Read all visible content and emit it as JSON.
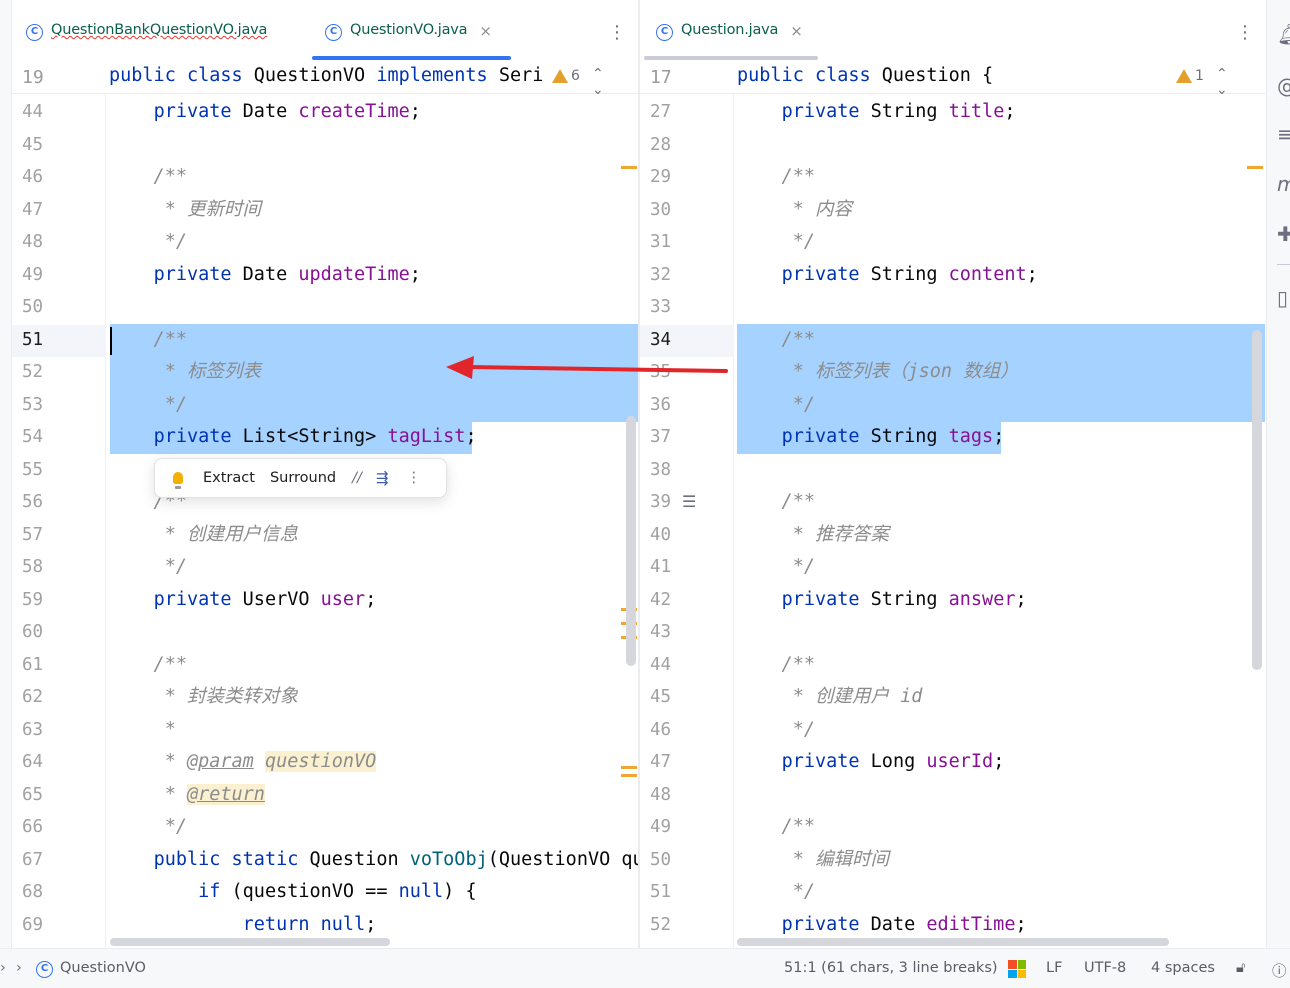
{
  "left_editor": {
    "tabs": [
      {
        "name": "QuestionBankQuestionVO.java",
        "icon": "class-icon",
        "error": true
      },
      {
        "name": "QuestionVO.java",
        "icon": "class-icon",
        "active": true,
        "close": "×"
      }
    ],
    "more": "⋮",
    "sticky": {
      "line_number": "19",
      "code": "public class QuestionVO implements Seri"
    },
    "warnings": "6",
    "nav": "^ v",
    "lines": [
      {
        "n": "44",
        "text": "    private Date createTime;"
      },
      {
        "n": "45",
        "text": ""
      },
      {
        "n": "46",
        "text": "    /**"
      },
      {
        "n": "47",
        "text": "     * 更新时间"
      },
      {
        "n": "48",
        "text": "     */"
      },
      {
        "n": "49",
        "text": "    private Date updateTime;"
      },
      {
        "n": "50",
        "text": ""
      },
      {
        "n": "51",
        "text": "    /**"
      },
      {
        "n": "52",
        "text": "     * 标签列表"
      },
      {
        "n": "53",
        "text": "     */"
      },
      {
        "n": "54",
        "text": "    private List<String> tagList;"
      },
      {
        "n": "55",
        "text": ""
      },
      {
        "n": "56",
        "text": "    /**"
      },
      {
        "n": "57",
        "text": "     * 创建用户信息"
      },
      {
        "n": "58",
        "text": "     */"
      },
      {
        "n": "59",
        "text": "    private UserVO user;"
      },
      {
        "n": "60",
        "text": ""
      },
      {
        "n": "61",
        "text": "    /**"
      },
      {
        "n": "62",
        "text": "     * 封装类转对象"
      },
      {
        "n": "63",
        "text": "     *"
      },
      {
        "n": "64",
        "text": "     * @param questionVO"
      },
      {
        "n": "65",
        "text": "     * @return"
      },
      {
        "n": "66",
        "text": "     */"
      },
      {
        "n": "67",
        "text": "    public static Question voToObj(QuestionVO qu"
      },
      {
        "n": "68",
        "text": "        if (questionVO == null) {"
      },
      {
        "n": "69",
        "text": "            return null;"
      }
    ],
    "popup": {
      "extract": "Extract",
      "surround": "Surround",
      "comment": "//",
      "more": "⋮"
    }
  },
  "right_editor": {
    "tabs": [
      {
        "name": "Question.java",
        "icon": "class-icon",
        "active": true,
        "close": "×"
      }
    ],
    "more": "⋮",
    "sticky": {
      "line_number": "17",
      "code": "public class Question {"
    },
    "warnings": "1",
    "nav": "^ v",
    "lines": [
      {
        "n": "27",
        "text": "    private String title;"
      },
      {
        "n": "28",
        "text": ""
      },
      {
        "n": "29",
        "text": "    /**"
      },
      {
        "n": "30",
        "text": "     * 内容"
      },
      {
        "n": "31",
        "text": "     */"
      },
      {
        "n": "32",
        "text": "    private String content;"
      },
      {
        "n": "33",
        "text": ""
      },
      {
        "n": "34",
        "text": "    /**"
      },
      {
        "n": "35",
        "text": "     * 标签列表（json 数组）"
      },
      {
        "n": "36",
        "text": "     */"
      },
      {
        "n": "37",
        "text": "    private String tags;"
      },
      {
        "n": "38",
        "text": ""
      },
      {
        "n": "39",
        "text": "    /**"
      },
      {
        "n": "40",
        "text": "     * 推荐答案"
      },
      {
        "n": "41",
        "text": "     */"
      },
      {
        "n": "42",
        "text": "    private String answer;"
      },
      {
        "n": "43",
        "text": ""
      },
      {
        "n": "44",
        "text": "    /**"
      },
      {
        "n": "45",
        "text": "     * 创建用户 id"
      },
      {
        "n": "46",
        "text": "     */"
      },
      {
        "n": "47",
        "text": "    private Long userId;"
      },
      {
        "n": "48",
        "text": ""
      },
      {
        "n": "49",
        "text": "    /**"
      },
      {
        "n": "50",
        "text": "     * 编辑时间"
      },
      {
        "n": "51",
        "text": "     */"
      },
      {
        "n": "52",
        "text": "    private Date editTime;"
      }
    ]
  },
  "statusbar": {
    "breadcrumb": "QuestionVO",
    "position": "51:1 (61 chars, 3 line breaks)",
    "line_ending": "LF",
    "encoding": "UTF-8",
    "indent": "4 spaces"
  },
  "colors": {
    "selection": "#a6d2ff",
    "keyword": "#0033b3",
    "field": "#871094",
    "comment": "#8c8c8c",
    "annotation_arrow": "#e0262b",
    "warning": "#e3a02b",
    "accent": "#3574f0"
  }
}
